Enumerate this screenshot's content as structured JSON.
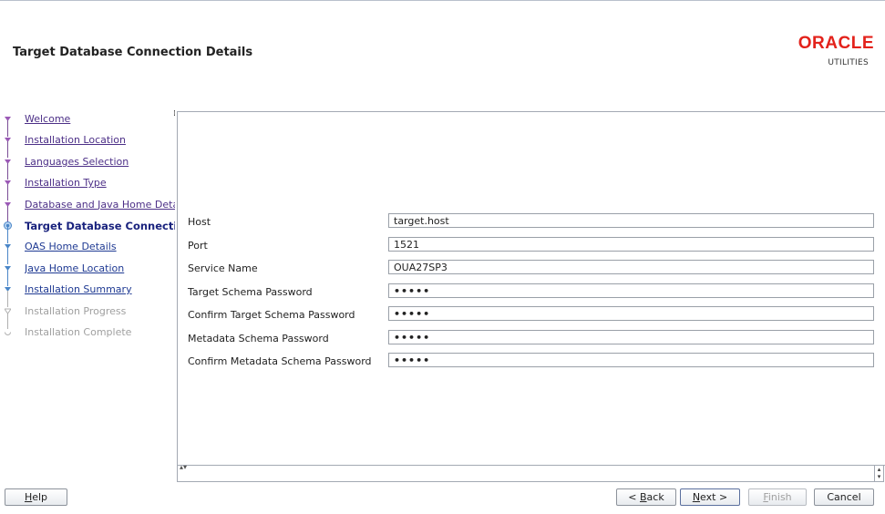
{
  "header": {
    "title": "Target Database Connection Details",
    "logo_brand": "ORACLE",
    "logo_sub": "UTILITIES"
  },
  "steps": [
    {
      "label": "Welcome",
      "state": "done"
    },
    {
      "label": "Installation Location",
      "state": "done"
    },
    {
      "label": "Languages Selection",
      "state": "done"
    },
    {
      "label": "Installation Type",
      "state": "done"
    },
    {
      "label": "Database and Java Home Details",
      "state": "done"
    },
    {
      "label": "Target Database Connection Details",
      "state": "current"
    },
    {
      "label": "OAS Home Details",
      "state": "pending-link"
    },
    {
      "label": "Java Home Location",
      "state": "pending-link"
    },
    {
      "label": "Installation Summary",
      "state": "pending-link"
    },
    {
      "label": "Installation Progress",
      "state": "disabled"
    },
    {
      "label": "Installation Complete",
      "state": "disabled"
    }
  ],
  "form": {
    "host": {
      "label": "Host",
      "value": "target.host"
    },
    "port": {
      "label": "Port",
      "value": "1521"
    },
    "service_name": {
      "label": "Service Name",
      "value": "OUA27SP3"
    },
    "target_schema_password": {
      "label": "Target Schema Password",
      "value": "•••••"
    },
    "confirm_target_schema_password": {
      "label": "Confirm Target Schema Password",
      "value": "•••••"
    },
    "metadata_schema_password": {
      "label": "Metadata Schema Password",
      "value": "•••••"
    },
    "confirm_metadata_schema_password": {
      "label": "Confirm Metadata Schema Password",
      "value": "•••••"
    }
  },
  "buttons": {
    "help": {
      "pre": "",
      "mnemonic": "H",
      "post": "elp"
    },
    "back": {
      "pre": "< ",
      "mnemonic": "B",
      "post": "ack"
    },
    "next": {
      "pre": "",
      "mnemonic": "N",
      "post": "ext >"
    },
    "finish": {
      "pre": "",
      "mnemonic": "F",
      "post": "inish"
    },
    "cancel": {
      "label": "Cancel"
    }
  },
  "colors": {
    "brand": "#e3221b",
    "link": "#4c2f87",
    "current_step": "#1a237e",
    "step_done": "#9b59b6",
    "step_pending": "#4a86c8",
    "step_disabled": "#a0a0a0"
  }
}
